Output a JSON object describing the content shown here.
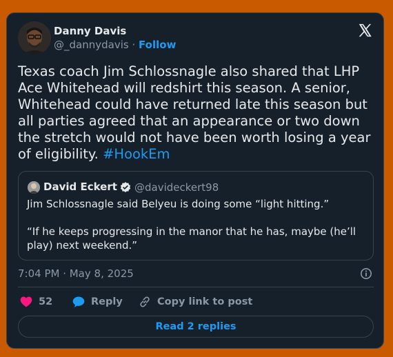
{
  "author": {
    "name": "Danny Davis",
    "handle": "@_dannydavis",
    "separator": "·",
    "follow_label": "Follow"
  },
  "tweet": {
    "text": "Texas coach Jim Schlossnagle also shared that LHP Ace Whitehead will redshirt this season. A senior, Whitehead could have returned late this season but all parties agreed that an appearance or two down the stretch would not have been worth losing a year of eligibility.",
    "hashtag": "#HookEm"
  },
  "quote": {
    "name": "David Eckert",
    "handle": "@davideckert98",
    "paragraphs": [
      "Jim Schlossnagle said Belyeu is doing some “light hitting.”",
      "“If he keeps progressing in the manor that he has, maybe (he’ll play) next weekend.”"
    ]
  },
  "meta": {
    "timestamp": "7:04 PM · May 8, 2025"
  },
  "actions": {
    "like_count": "52",
    "reply_label": "Reply",
    "copy_label": "Copy link to post"
  },
  "replies_button": "Read 2 replies",
  "colors": {
    "page_bg": "#c95a00",
    "card_bg": "#15202b",
    "accent": "#1d9bf0",
    "like": "#f91880"
  },
  "icons": [
    "x-logo-icon",
    "verified-badge-icon",
    "info-icon",
    "heart-icon",
    "reply-bubble-icon",
    "link-icon"
  ]
}
